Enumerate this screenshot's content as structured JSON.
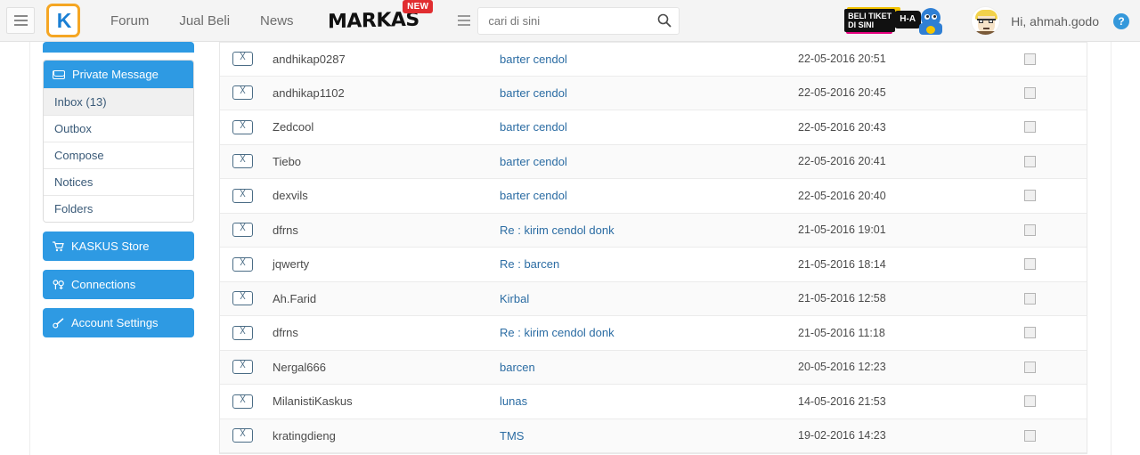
{
  "header": {
    "menu_icon": "hamburger-icon",
    "logo_text": "K",
    "nav": [
      {
        "label": "Forum"
      },
      {
        "label": "Jual Beli"
      },
      {
        "label": "News"
      }
    ],
    "markas_label": "MARKAS",
    "markas_badge": "NEW",
    "search": {
      "placeholder": "cari di sini",
      "value": "",
      "icon": "search-icon"
    },
    "ticket_banner": {
      "line1": "BELI TIKET",
      "line2": "DI SINI",
      "bubble": "H-A"
    },
    "greeting": "Hi, ahmah.godo",
    "help_icon": "question-mark-icon"
  },
  "sidebar": {
    "section": {
      "title": "Private Message",
      "icon": "envelope-icon",
      "items": [
        {
          "label": "Inbox (13)",
          "active": true
        },
        {
          "label": "Outbox",
          "active": false
        },
        {
          "label": "Compose",
          "active": false
        },
        {
          "label": "Notices",
          "active": false
        },
        {
          "label": "Folders",
          "active": false
        }
      ]
    },
    "buttons": [
      {
        "label": "KASKUS Store",
        "icon": "cart-icon",
        "glyph": "⛟"
      },
      {
        "label": "Connections",
        "icon": "connections-icon",
        "glyph": "⚭"
      },
      {
        "label": "Account Settings",
        "icon": "wrench-icon",
        "glyph": "⚒"
      }
    ]
  },
  "messages": {
    "icon": "envelope-icon",
    "rows": [
      {
        "user": "andhikap0287",
        "subject": "barter cendol",
        "date": "22-05-2016 20:51",
        "checked": false
      },
      {
        "user": "andhikap1102",
        "subject": "barter cendol",
        "date": "22-05-2016 20:45",
        "checked": false
      },
      {
        "user": "Zedcool",
        "subject": "barter cendol",
        "date": "22-05-2016 20:43",
        "checked": false
      },
      {
        "user": "Tiebo",
        "subject": "barter cendol",
        "date": "22-05-2016 20:41",
        "checked": false
      },
      {
        "user": "dexvils",
        "subject": "barter cendol",
        "date": "22-05-2016 20:40",
        "checked": false
      },
      {
        "user": "dfrns",
        "subject": "Re : kirim cendol donk",
        "date": "21-05-2016 19:01",
        "checked": false
      },
      {
        "user": "jqwerty",
        "subject": "Re : barcen",
        "date": "21-05-2016 18:14",
        "checked": false
      },
      {
        "user": "Ah.Farid",
        "subject": "Kirbal",
        "date": "21-05-2016 12:58",
        "checked": false
      },
      {
        "user": "dfrns",
        "subject": "Re : kirim cendol donk",
        "date": "21-05-2016 11:18",
        "checked": false
      },
      {
        "user": "Nergal666",
        "subject": "barcen",
        "date": "20-05-2016 12:23",
        "checked": false
      },
      {
        "user": "MilanistiKaskus",
        "subject": "lunas",
        "date": "14-05-2016 21:53",
        "checked": false
      },
      {
        "user": "kratingdieng",
        "subject": "TMS",
        "date": "19-02-2016 14:23",
        "checked": false
      }
    ]
  },
  "colors": {
    "accent_blue": "#2e9ae3",
    "link_blue": "#2b6ca3",
    "badge_red": "#e12d30",
    "logo_orange": "#f5a623"
  }
}
